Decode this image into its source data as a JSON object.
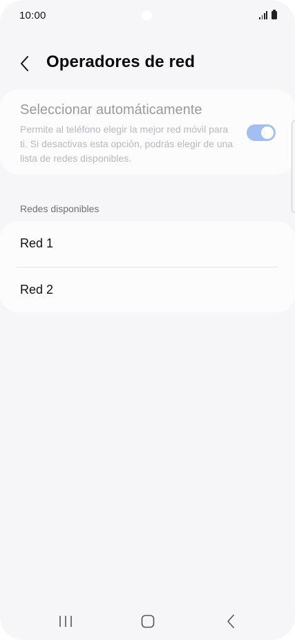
{
  "status_bar": {
    "time": "10:00",
    "signal_icon": "signal-bars-icon",
    "battery_icon": "battery-icon"
  },
  "header": {
    "back_icon": "chevron-left-icon",
    "title": "Operadores de red"
  },
  "auto_select": {
    "title": "Seleccionar automáticamente",
    "description": "Permite al teléfono elegir la mejor red móvil para ti. Si desactivas esta opción, podrás elegir de una lista de redes disponibles.",
    "toggle_on": true,
    "toggle_enabled": false
  },
  "networks": {
    "section_label": "Redes disponibles",
    "items": [
      {
        "label": "Red 1"
      },
      {
        "label": "Red 2"
      }
    ]
  },
  "nav_bar": {
    "recent_icon": "recent-apps-icon",
    "home_icon": "home-icon",
    "back_icon": "back-icon"
  },
  "colors": {
    "background": "#f6f6f8",
    "card": "#fcfcfd",
    "toggle_track": "#a3bff2",
    "disabled_text": "#9a9a9c"
  }
}
